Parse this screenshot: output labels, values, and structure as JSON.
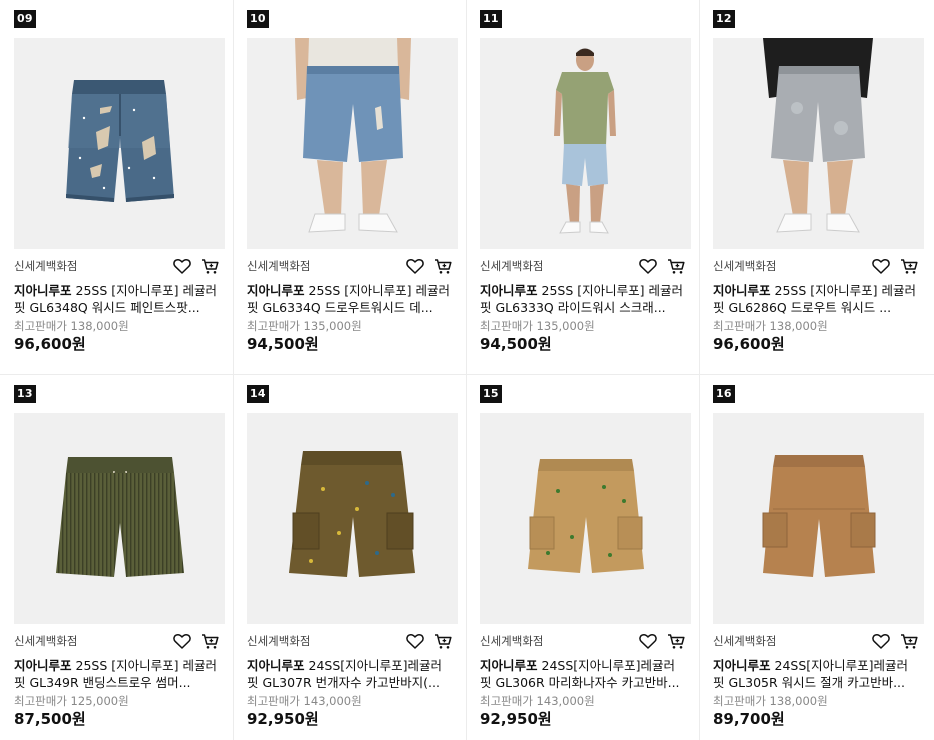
{
  "products": [
    {
      "rank": "09",
      "seller": "신세계백화점",
      "brand": "지아니루포",
      "name": "25SS [지아니루포] 레귤러핏 GL6348Q 워시드 페인트스팟...",
      "original_price": "최고판매가 138,000원",
      "price": "96,600원",
      "image": "denim-shorts-distressed"
    },
    {
      "rank": "10",
      "seller": "신세계백화점",
      "brand": "지아니루포",
      "name": "25SS [지아니루포] 레귤러핏 GL6334Q 드로우트워시드 데...",
      "original_price": "최고판매가 135,000원",
      "price": "94,500원",
      "image": "model-denim-shorts"
    },
    {
      "rank": "11",
      "seller": "신세계백화점",
      "brand": "지아니루포",
      "name": "25SS [지아니루포] 레귤러핏 GL6333Q 라이드워시 스크래...",
      "original_price": "최고판매가 135,000원",
      "price": "94,500원",
      "image": "model-light-denim-shorts"
    },
    {
      "rank": "12",
      "seller": "신세계백화점",
      "brand": "지아니루포",
      "name": "25SS [지아니루포] 레귤러핏 GL6286Q 드로우트 워시드 ...",
      "original_price": "최고판매가 138,000원",
      "price": "96,600원",
      "image": "model-grey-denim-shorts"
    },
    {
      "rank": "13",
      "seller": "신세계백화점",
      "brand": "지아니루포",
      "name": "25SS [지아니루포] 레귤러핏 GL349R 밴딩스트로우 썸머...",
      "original_price": "최고판매가 125,000원",
      "price": "87,500원",
      "image": "olive-striped-shorts"
    },
    {
      "rank": "14",
      "seller": "신세계백화점",
      "brand": "지아니루포",
      "name": "24SS[지아니루포]레귤러핏 GL307R 번개자수 카고반바지(...",
      "original_price": "최고판매가 143,000원",
      "price": "92,950원",
      "image": "brown-cargo-shorts"
    },
    {
      "rank": "15",
      "seller": "신세계백화점",
      "brand": "지아니루포",
      "name": "24SS[지아니루포]레귤러핏 GL306R 마리화나자수 카고반바...",
      "original_price": "최고판매가 143,000원",
      "price": "92,950원",
      "image": "khaki-cargo-shorts"
    },
    {
      "rank": "16",
      "seller": "신세계백화점",
      "brand": "지아니루포",
      "name": "24SS[지아니루포]레귤러핏 GL305R 워시드 절개 카고반바...",
      "original_price": "최고판매가 138,000원",
      "price": "89,700원",
      "image": "tan-cargo-shorts"
    }
  ],
  "colors": {
    "image_bg": "#f0f0f0",
    "rank_badge_bg": "#111111",
    "denim_dark": "#3f5f7c",
    "denim_mid": "#6f8fb0",
    "denim_light": "#a9c3da",
    "denim_grey": "#a9adb2",
    "olive": "#5a5f39",
    "brown_cargo": "#6e5a2e",
    "khaki": "#c39a5e",
    "tan": "#b6824f"
  }
}
